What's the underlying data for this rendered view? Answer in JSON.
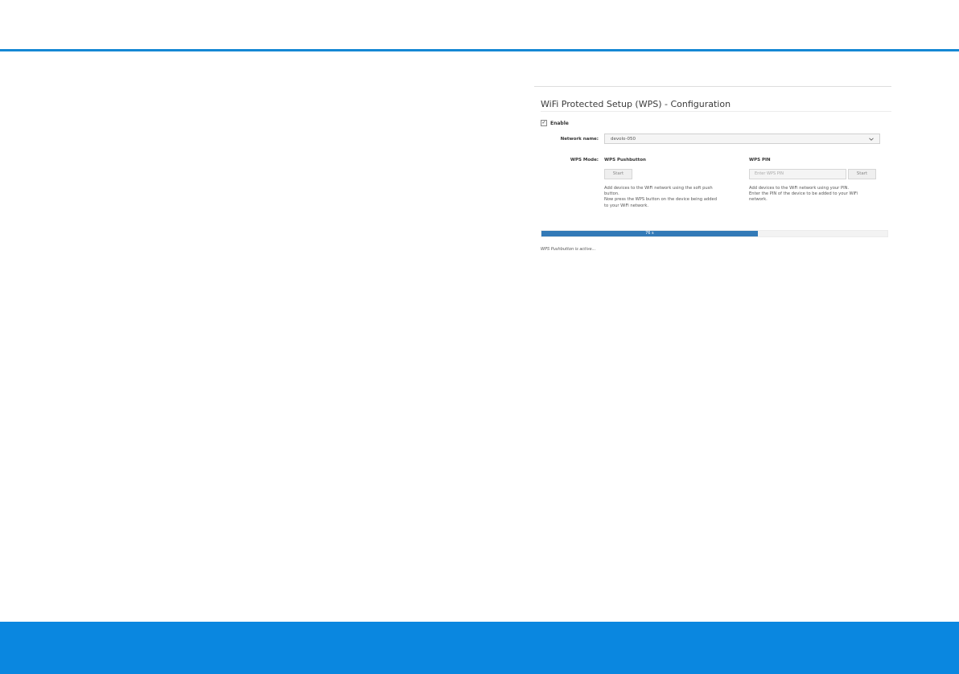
{
  "colors": {
    "accent": "#1588d4",
    "footer": "#0a87e0",
    "progress": "#337ab7"
  },
  "panel": {
    "title": "WiFi Protected Setup (WPS) - Configuration",
    "enable": {
      "label": "Enable",
      "checked": true
    },
    "network_name": {
      "label": "Network name:",
      "value": "devolo-050",
      "icon": "chevron-down-icon"
    },
    "wps_mode": {
      "label": "WPS Mode:",
      "pushbutton": {
        "title": "WPS Pushbutton",
        "button": "Start",
        "desc_lines": [
          "Add devices to the WiFi network using the soft push",
          "button.",
          "Now press the WPS button on the device being added",
          "to your WiFi network."
        ]
      },
      "pin": {
        "title": "WPS PIN",
        "placeholder": "Enter WPS PIN",
        "button": "Start",
        "desc_lines": [
          "Add devices to the WiFi network using your PIN.",
          "Enter the PIN of the device to be added to your WiFi",
          "network."
        ]
      }
    },
    "progress": {
      "label": "76 s",
      "fraction": 0.625
    },
    "status": "WPS Pushbutton is active..."
  }
}
